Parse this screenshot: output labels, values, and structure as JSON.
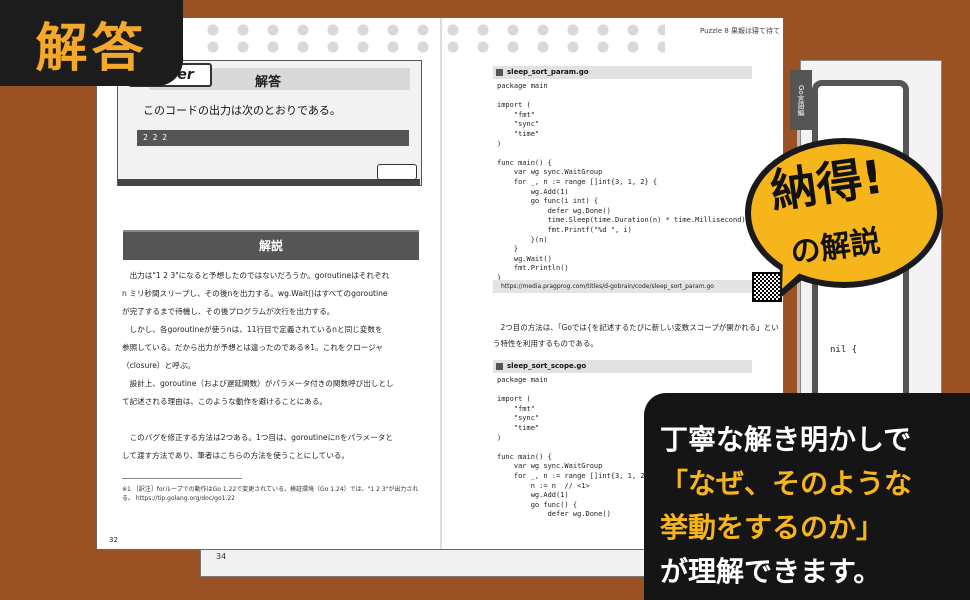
{
  "tag": {
    "label": "解答"
  },
  "header": {
    "right_page_title": "Puzzle 8  果報は寝て待て",
    "side_tab": "Go言語編"
  },
  "answer": {
    "badge": "nswer",
    "heading": "解答",
    "text": "このコードの出力は次のとおりである。",
    "output": "2 2 2"
  },
  "kaisetsu": {
    "heading": "解説",
    "lines": [
      "　出力は\"1 2 3\"になると予想したのではないだろうか。goroutineはそれぞれ",
      "n ミリ秒間スリープし、その後nを出力する。wg.Wait()はすべてのgoroutine",
      "が完了するまで待機し、その後プログラムが次行を出力する。",
      "　しかし、各goroutineが使うnは、11行目で定義されているnと同じ変数を",
      "参照している。だから出力が予想とは違ったのである※1。これをクロージャ",
      "（closure）と呼ぶ。",
      "　設計上、goroutine（および遅延関数）がパラメータ付きの関数呼び出しとし",
      "て記述される理由は、このような動作を避けることにある。",
      "",
      "　このバグを修正する方法は2つある。1つ目は、goroutineにnをパラメータと",
      "して渡す方法であり、筆者はこちらの方法を使うことにしている。"
    ],
    "footnote": "※1 ［訳注］forループでの動作はGo 1.22で変更されている。検証環境（Go 1.24）では、\"1 2 3\"が出力される。 https://tip.golang.org/doc/go1.22",
    "page_number": "32"
  },
  "code1": {
    "filename": "sleep_sort_param.go",
    "source": "package main\n\nimport (\n    \"fmt\"\n    \"sync\"\n    \"time\"\n)\n\nfunc main() {\n    var wg sync.WaitGroup\n    for _, n := range []int{3, 1, 2} {\n        wg.Add(1)\n        go func(i int) {\n            defer wg.Done()\n            time.Sleep(time.Duration(n) * time.Millisecond)\n            fmt.Printf(\"%d \", i)\n        }(n)\n    }\n    wg.Wait()\n    fmt.Println()\n}"
  },
  "url": "https://media.pragprog.com/titles/d-gobrain/code/sleep_sort_param.go",
  "mid_text": "　2つ目の方法は、「Goでは{を記述するたびに新しい変数スコープが開かれる」という特性を利用するものである。",
  "code2": {
    "filename": "sleep_sort_scope.go",
    "source": "package main\n\nimport (\n    \"fmt\"\n    \"sync\"\n    \"time\"\n)\n\nfunc main() {\n    var wg sync.WaitGroup\n    for _, n := range []int{3, 1, 2\n        n := n  // <1>\n        wg.Add(1)\n        go func() {\n            defer wg.Done()"
  },
  "back_page": {
    "code_fragment": "nil {",
    "page_number": "34"
  },
  "bubble": {
    "line1": "納得!",
    "line2": "の解説"
  },
  "caption": {
    "line1": "丁寧な解き明かしで",
    "line2": "「なぜ、そのような",
    "line3": "挙動をするのか」",
    "line4": "が理解できます。"
  },
  "colors": {
    "background": "#9a5224",
    "accent": "#f7b51c",
    "dark": "#151515"
  }
}
